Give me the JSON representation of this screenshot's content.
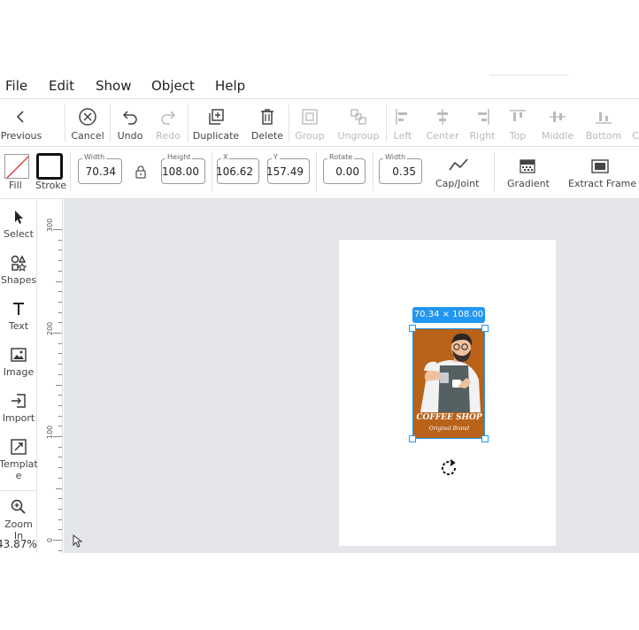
{
  "menu": [
    "File",
    "Edit",
    "Show",
    "Object",
    "Help"
  ],
  "toolbar1": {
    "previous": "Previous",
    "cancel": "Cancel",
    "undo": "Undo",
    "redo": "Redo",
    "duplicate": "Duplicate",
    "delete": "Delete",
    "group": "Group",
    "ungroup": "Ungroup",
    "left": "Left",
    "center": "Center",
    "right": "Right",
    "top": "Top",
    "middle": "Middle",
    "bottom": "Bottom",
    "cut_off": "C"
  },
  "toolbar2": {
    "fill": "Fill",
    "stroke": "Stroke",
    "width_caption": "Width",
    "width_value": "70.34",
    "height_caption": "Height",
    "height_value": "108.00",
    "x_caption": "X",
    "x_value": "106.62",
    "y_caption": "Y",
    "y_value": "157.49",
    "rotate_caption": "Rotate",
    "rotate_value": "0.00",
    "stroke_width_caption": "Width",
    "stroke_width_value": "0.35",
    "cap_joint": "Cap/Joint",
    "gradient": "Gradient",
    "extract_frame": "Extract Frame"
  },
  "left_panel": {
    "select": "Select",
    "shapes": "Shapes",
    "text": "Text",
    "image": "Image",
    "import": "Import",
    "template": "Templat\ne",
    "zoom_in": "Zoom In",
    "zoom_level": "43.87%"
  },
  "ruler_labels": [
    "300",
    "200",
    "100",
    "0"
  ],
  "canvas": {
    "selection_size": "70.34 × 108.00",
    "image_title": "COFFEE SHOP",
    "image_subtitle": "Original Brand"
  },
  "colors": {
    "accent": "#2196f3",
    "canvas_bg": "#e4e6ea",
    "image_bg": "#b8621a",
    "fill_none_slash": "#e0463b"
  }
}
